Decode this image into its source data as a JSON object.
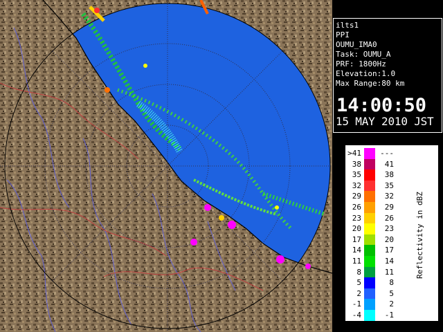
{
  "info": {
    "lines": [
      "ilts1",
      "PPI",
      "OUMU_IMA0",
      "Task: OUMU_A",
      "PRF: 1800Hz",
      "Elevation:1.0",
      "Max Range:80 km"
    ],
    "time": "14:00:50",
    "date": "15 MAY 2010 JST"
  },
  "legend": {
    "unit": "Reflectivity in dBZ",
    "bins": [
      {
        "lo": ">41",
        "hi": "---",
        "color": "#ff00ff"
      },
      {
        "lo": "38",
        "hi": "41",
        "color": "#c00060"
      },
      {
        "lo": "35",
        "hi": "38",
        "color": "#ff0000"
      },
      {
        "lo": "32",
        "hi": "35",
        "color": "#ff3030"
      },
      {
        "lo": "29",
        "hi": "32",
        "color": "#ff7000"
      },
      {
        "lo": "26",
        "hi": "29",
        "color": "#ffa000"
      },
      {
        "lo": "23",
        "hi": "26",
        "color": "#ffd000"
      },
      {
        "lo": "20",
        "hi": "23",
        "color": "#ffff00"
      },
      {
        "lo": "17",
        "hi": "20",
        "color": "#a0e000"
      },
      {
        "lo": "14",
        "hi": "17",
        "color": "#00c000"
      },
      {
        "lo": "11",
        "hi": "14",
        "color": "#00e000"
      },
      {
        "lo": "8",
        "hi": "11",
        "color": "#00a040"
      },
      {
        "lo": "5",
        "hi": "8",
        "color": "#0000ff"
      },
      {
        "lo": "2",
        "hi": "5",
        "color": "#2060ff"
      },
      {
        "lo": "-1",
        "hi": "2",
        "color": "#00a0ff"
      },
      {
        "lo": "-4",
        "hi": "-1",
        "color": "#00ffff"
      }
    ]
  },
  "colors": {
    "radar_outer": "#1e5fe0",
    "radar_inner": "#1a57e6",
    "land": "#8a7458",
    "rings": "#2a2a6a",
    "coast": "#000000"
  }
}
